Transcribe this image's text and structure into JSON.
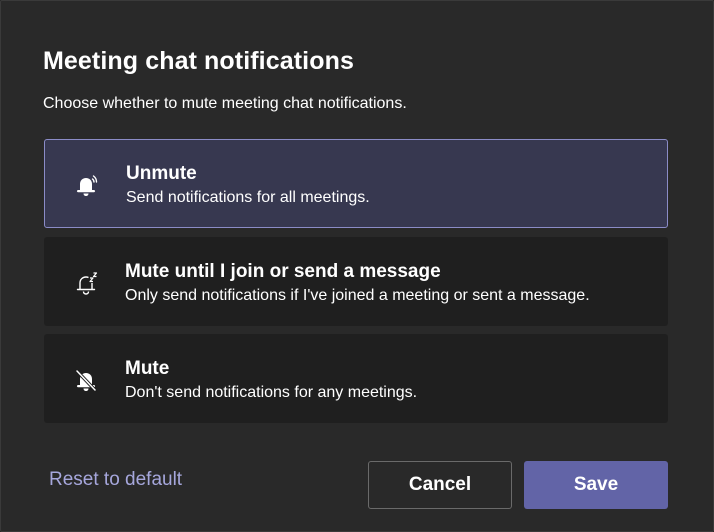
{
  "dialog": {
    "title": "Meeting chat notifications",
    "subtitle": "Choose whether to mute meeting chat notifications."
  },
  "options": [
    {
      "title": "Unmute",
      "description": "Send notifications for all meetings.",
      "icon": "bell-ringing-icon",
      "selected": true
    },
    {
      "title": "Mute until I join or send a message",
      "description": "Only send notifications if I've joined a meeting or sent a message.",
      "icon": "bell-snooze-icon",
      "selected": false
    },
    {
      "title": "Mute",
      "description": "Don't send notifications for any meetings.",
      "icon": "bell-off-icon",
      "selected": false
    }
  ],
  "footer": {
    "reset_label": "Reset to default",
    "cancel_label": "Cancel",
    "save_label": "Save"
  },
  "colors": {
    "dialog_background": "#292929",
    "option_background": "#1f1f1f",
    "selected_background": "#373850",
    "selected_border": "#8b8cc7",
    "link": "#a6a7dc",
    "primary_button": "#6264a7"
  }
}
